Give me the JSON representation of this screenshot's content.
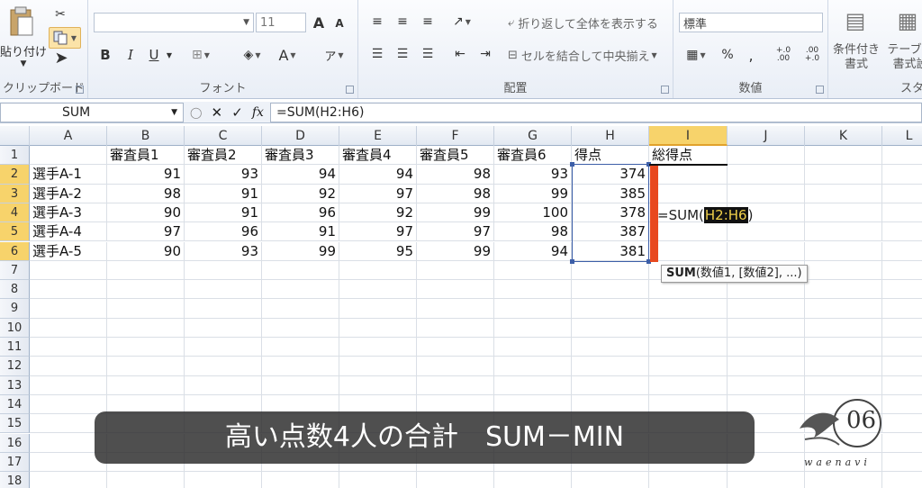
{
  "ribbon": {
    "clipboard": {
      "paste_label": "貼り付け",
      "group_label": "クリップボード"
    },
    "font": {
      "font_size": "11",
      "bold": "B",
      "italic": "I",
      "underline": "U",
      "font_color": "A",
      "phonetic": "ア",
      "grow": "A",
      "shrink": "A",
      "group_label": "フォント"
    },
    "alignment": {
      "wrap_text": "折り返して全体を表示する",
      "merge_center": "セルを結合して中央揃え",
      "group_label": "配置"
    },
    "number": {
      "format": "標準",
      "percent": "%",
      "comma": ",",
      "inc_decimal": "+.0 .00",
      "dec_decimal": ".00 +.0",
      "group_label": "数値"
    },
    "styles": {
      "conditional_format": "条件付き\n書式",
      "table_format": "テーブル\n書式設",
      "group_label": "スタ"
    }
  },
  "formula_bar": {
    "name_box": "SUM",
    "cancel": "✕",
    "enter": "✓",
    "fx": "fx",
    "formula": "=SUM(H2:H6)"
  },
  "columns": [
    "A",
    "B",
    "C",
    "D",
    "E",
    "F",
    "G",
    "H",
    "I",
    "J",
    "K",
    "L"
  ],
  "rows": [
    [
      "",
      "審査員1",
      "審査員2",
      "審査員3",
      "審査員4",
      "審査員5",
      "審査員6",
      "得点",
      "総得点"
    ],
    [
      "選手A-1",
      "91",
      "93",
      "94",
      "94",
      "98",
      "93",
      "374",
      ""
    ],
    [
      "選手A-2",
      "98",
      "91",
      "92",
      "97",
      "98",
      "99",
      "385",
      ""
    ],
    [
      "選手A-3",
      "90",
      "91",
      "96",
      "92",
      "99",
      "100",
      "378",
      ""
    ],
    [
      "選手A-4",
      "97",
      "96",
      "91",
      "97",
      "97",
      "98",
      "387",
      ""
    ],
    [
      "選手A-5",
      "90",
      "93",
      "99",
      "95",
      "99",
      "94",
      "381",
      ""
    ]
  ],
  "row_numbers": [
    "1",
    "2",
    "3",
    "4",
    "5",
    "6",
    "7",
    "8",
    "9",
    "10",
    "11",
    "12",
    "13",
    "14",
    "15",
    "16",
    "17",
    "18"
  ],
  "editing": {
    "prefix": "=SUM(",
    "ref": "H2:H6",
    "suffix": ")"
  },
  "tooltip": {
    "func": "SUM",
    "args": "(数値1, [数値2], ...)"
  },
  "caption": "高い点数4人の合計　SUM－MIN",
  "logo": {
    "text": "waenavi",
    "mark": "06"
  },
  "colors": {
    "selected_header": "#f7d36b",
    "edit_bar": "#e8481f",
    "range_border": "#3d5fa8"
  }
}
